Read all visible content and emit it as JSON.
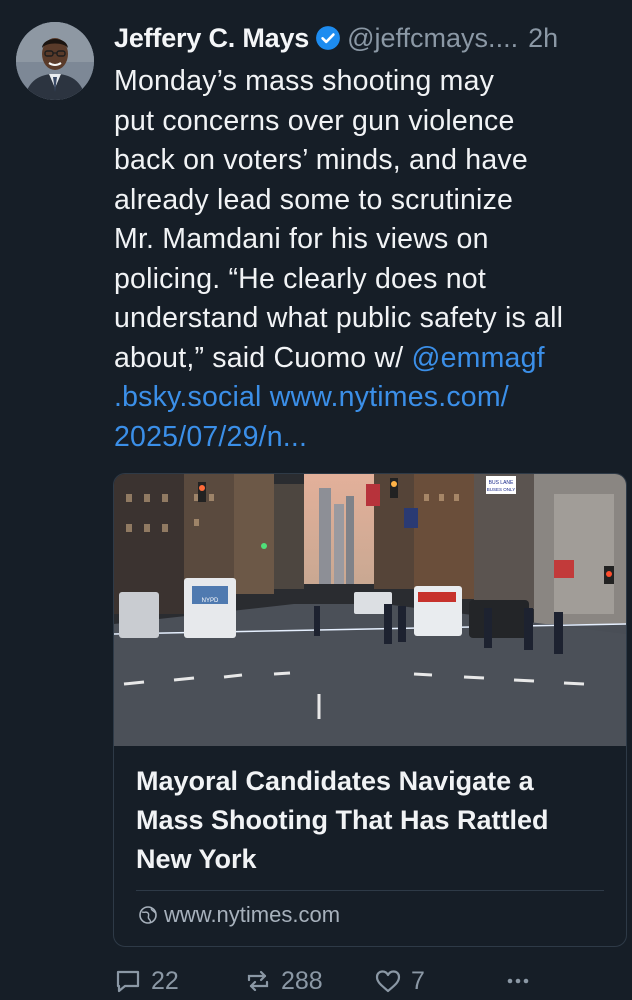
{
  "post": {
    "author": {
      "display_name": "Jeffery C. Mays",
      "handle": "@jeffcmays.",
      "handle_ellipsis": "...",
      "time": "2h"
    },
    "text_lines": [
      "Monday’s mass shooting may",
      "put concerns over gun violence",
      "back on voters’ minds, and have",
      "already lead some to scrutinize",
      "Mr. Mamdani for his views on",
      "policing. “He clearly does not",
      "understand what public safety is all"
    ],
    "line8_text": "about,” said Cuomo w/ ",
    "mention_part1": "@emmagf",
    "mention_part2": ".bsky.social",
    "url_part1": "www.nytimes.com/",
    "url_part2": "2025/07/29/n..."
  },
  "card": {
    "title_lines": [
      "Mayoral Candidates Navigate a",
      "Mass Shooting That Has Rattled",
      "New York"
    ],
    "domain": "www.nytimes.com",
    "image_signs": {
      "bus_lane": "BUS LANE",
      "buses_only": "BUSES ONLY",
      "ambulance": "NYPD"
    }
  },
  "actions": {
    "replies": "22",
    "reposts": "288",
    "likes": "7"
  },
  "colors": {
    "background": "#161e27",
    "link": "#3b8fe8",
    "muted": "#8b98a5",
    "verified": "#1d8cf0"
  },
  "icons": [
    "verified-badge-icon",
    "globe-icon",
    "reply-icon",
    "repost-icon",
    "like-icon",
    "more-icon"
  ]
}
